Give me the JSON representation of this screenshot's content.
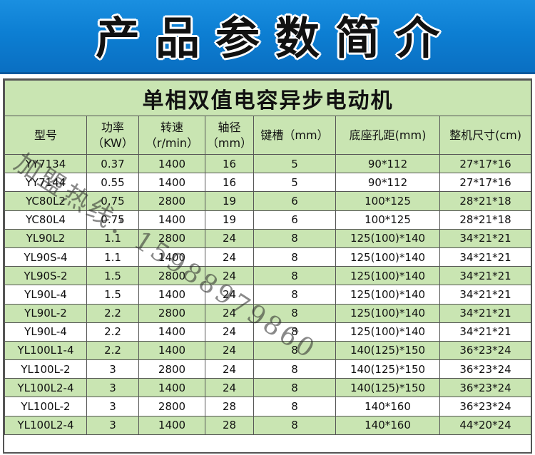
{
  "banner": {
    "title": "产品参数简介"
  },
  "table": {
    "title": "单相双值电容异步电动机",
    "headers": [
      [
        "型号",
        ""
      ],
      [
        "功率",
        "（KW）"
      ],
      [
        "转速",
        "（r/min）"
      ],
      [
        "轴径",
        "（mm）"
      ],
      [
        "键槽（mm）",
        ""
      ],
      [
        "底座孔距(mm)",
        ""
      ],
      [
        "整机尺寸(cm)",
        ""
      ]
    ],
    "rows": [
      [
        "YY7134",
        "0.37",
        "1400",
        "16",
        "5",
        "90*112",
        "27*17*16"
      ],
      [
        "YY7144",
        "0.55",
        "1400",
        "16",
        "5",
        "90*112",
        "27*17*16"
      ],
      [
        "YC80L2",
        "0.75",
        "2800",
        "19",
        "6",
        "100*125",
        "28*21*18"
      ],
      [
        "YC80L4",
        "0.75",
        "1400",
        "19",
        "6",
        "100*125",
        "28*21*18"
      ],
      [
        "YL90L2",
        "1.1",
        "2800",
        "24",
        "8",
        "125(100)*140",
        "34*21*21"
      ],
      [
        "YL90S-4",
        "1.1",
        "1400",
        "24",
        "8",
        "125(100)*140",
        "34*21*21"
      ],
      [
        "YL90S-2",
        "1.5",
        "2800",
        "24",
        "8",
        "125(100)*140",
        "34*21*21"
      ],
      [
        "YL90L-4",
        "1.5",
        "1400",
        "24",
        "8",
        "125(100)*140",
        "34*21*21"
      ],
      [
        "YL90L-2",
        "2.2",
        "2800",
        "24",
        "8",
        "125(100)*140",
        "34*21*21"
      ],
      [
        "YL90L-4",
        "2.2",
        "1400",
        "24",
        "8",
        "125(100)*140",
        "34*21*21"
      ],
      [
        "YL100L1-4",
        "2.2",
        "1400",
        "24",
        "8",
        "140(125)*150",
        "36*23*24"
      ],
      [
        "YL100L-2",
        "3",
        "2800",
        "24",
        "8",
        "140(125)*150",
        "36*23*24"
      ],
      [
        "YL100L2-4",
        "3",
        "1400",
        "24",
        "8",
        "140(125)*150",
        "36*23*24"
      ],
      [
        "YL100L-2",
        "3",
        "2800",
        "28",
        "8",
        "140*160",
        "36*23*24"
      ],
      [
        "YL100L2-4",
        "3",
        "1400",
        "28",
        "8",
        "140*160",
        "44*20*24"
      ]
    ]
  },
  "watermark": "加盟热线：15988979860",
  "colors": {
    "banner": "#0d7fd3",
    "row_alt": "#c9e5b2"
  }
}
